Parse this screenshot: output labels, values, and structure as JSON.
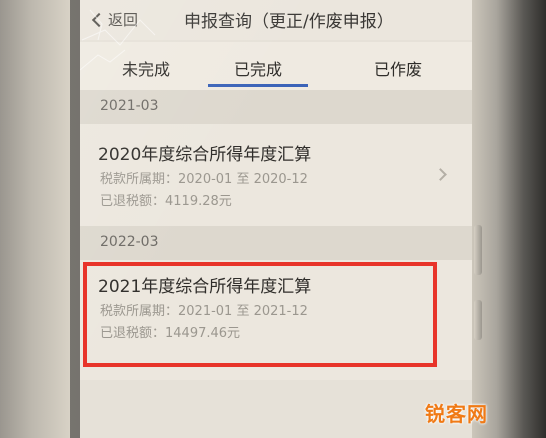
{
  "header": {
    "back_label": "返回",
    "title": "申报查询（更正/作废申报）"
  },
  "tabs": [
    {
      "label": "未完成"
    },
    {
      "label": "已完成",
      "selected": true
    },
    {
      "label": "已作废"
    }
  ],
  "groups": [
    {
      "date": "2021-03",
      "title": "2020年度综合所得年度汇算",
      "period": "税款所属期：2020-01 至 2020-12",
      "refund": "已退税额：4119.28元"
    },
    {
      "date": "2022-03",
      "title": "2021年度综合所得年度汇算",
      "period": "税款所属期：2021-01 至 2021-12",
      "refund": "已退税额：14497.46元"
    }
  ],
  "watermark": "锐客网",
  "colors": {
    "accent": "#3b63b8",
    "highlight": "#e8342a",
    "watermark": "#f07a16"
  }
}
